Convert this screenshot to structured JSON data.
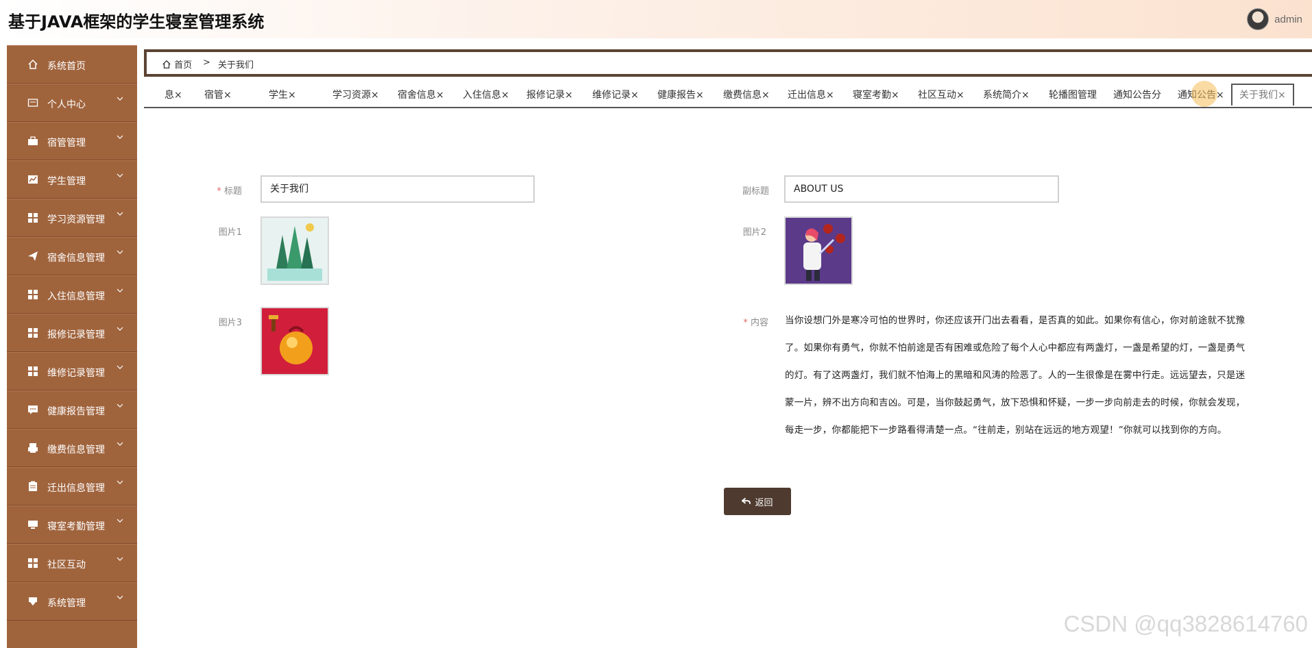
{
  "header": {
    "app_title": "基于JAVA框架的学生寝室管理系统",
    "username": "admin"
  },
  "sidebar": {
    "items": [
      {
        "label": "系统首页",
        "icon": "home-icon",
        "has_arrow": false
      },
      {
        "label": "个人中心",
        "icon": "id-card-icon",
        "has_arrow": true
      },
      {
        "label": "宿管管理",
        "icon": "briefcase-icon",
        "has_arrow": true
      },
      {
        "label": "学生管理",
        "icon": "chart-icon",
        "has_arrow": true
      },
      {
        "label": "学习资源管理",
        "icon": "grid-icon",
        "has_arrow": true
      },
      {
        "label": "宿舍信息管理",
        "icon": "paper-plane-icon",
        "has_arrow": true
      },
      {
        "label": "入住信息管理",
        "icon": "grid-icon",
        "has_arrow": true
      },
      {
        "label": "报修记录管理",
        "icon": "grid-icon",
        "has_arrow": true
      },
      {
        "label": "维修记录管理",
        "icon": "grid-icon",
        "has_arrow": true
      },
      {
        "label": "健康报告管理",
        "icon": "chat-icon",
        "has_arrow": true
      },
      {
        "label": "缴费信息管理",
        "icon": "printer-icon",
        "has_arrow": true
      },
      {
        "label": "迁出信息管理",
        "icon": "clipboard-icon",
        "has_arrow": true
      },
      {
        "label": "寝室考勤管理",
        "icon": "monitor-icon",
        "has_arrow": true
      },
      {
        "label": "社区互动",
        "icon": "grid-icon",
        "has_arrow": true
      },
      {
        "label": "系统管理",
        "icon": "flag-icon",
        "has_arrow": true
      }
    ]
  },
  "breadcrumb": {
    "home": "首页",
    "separator": ">",
    "current": "关于我们"
  },
  "tabs": [
    "息×",
    "宿管×",
    "学生×",
    "学习资源×",
    "宿舍信息×",
    "入住信息×",
    "报修记录×",
    "维修记录×",
    "健康报告×",
    "缴费信息×",
    "迁出信息×",
    "寝室考勤×",
    "社区互动×",
    "系统简介×",
    "轮播图管理",
    "通知公告分",
    "通知公告×",
    "关于我们×"
  ],
  "form": {
    "title_label": "标题",
    "title_value": "关于我们",
    "subtitle_label": "副标题",
    "subtitle_value": "ABOUT US",
    "image1_label": "图片1",
    "image2_label": "图片2",
    "image3_label": "图片3",
    "content_label": "内容",
    "required_mark": "*",
    "content_value": "当你设想门外是寒冷可怕的世界时，你还应该开门出去看看，是否真的如此。如果你有信心，你对前途就不犹豫了。如果你有勇气，你就不怕前途是否有困难或危险了每个人心中都应有两盏灯，一盏是希望的灯，一盏是勇气的灯。有了这两盏灯，我们就不怕海上的黑暗和风涛的险恶了。人的一生很像是在雾中行走。远远望去，只是迷蒙一片，辨不出方向和吉凶。可是，当你鼓起勇气，放下恐惧和怀疑，一步一步向前走去的时候，你就会发现，每走一步，你都能把下一步路看得清楚一点。“往前走，别站在远远的地方观望！”你就可以找到你的方向。",
    "back_label": "返回"
  },
  "watermark": "CSDN @qq3828614760",
  "colors": {
    "sidebar_bg": "#a0643d",
    "button_bg": "#4e3a2e",
    "breadcrumb_border": "#5b4334"
  }
}
